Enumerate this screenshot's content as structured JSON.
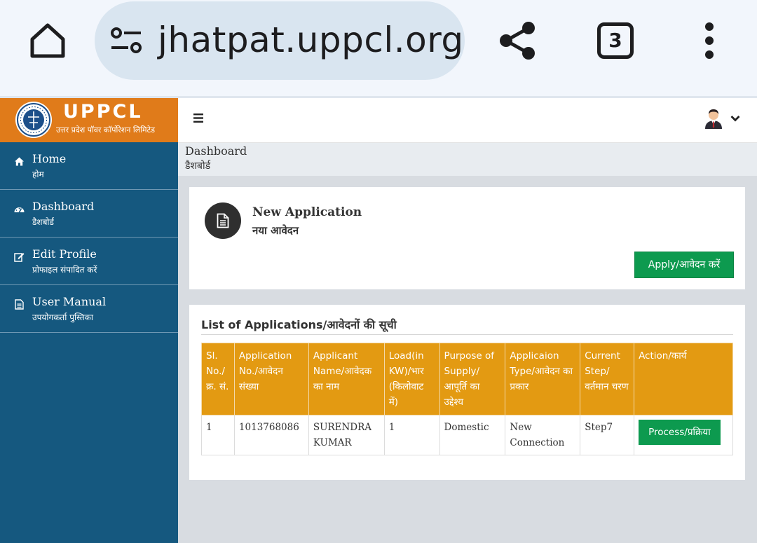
{
  "browser": {
    "url": "jhatpat.uppcl.org/c",
    "tab_count": "3",
    "icons": [
      "home-icon",
      "site-settings-icon",
      "share-icon",
      "tabs-icon",
      "overflow-menu-icon"
    ]
  },
  "brand": {
    "name": "UPPCL",
    "subtitle": "उत्तर प्रदेश पॉवर कॉर्पोरेशन लिमिटेड",
    "color": "#e07b1a"
  },
  "sidebar": {
    "color": "#15587f",
    "items": [
      {
        "label": "Home",
        "label_hi": "होम",
        "icon": "home-icon"
      },
      {
        "label": "Dashboard",
        "label_hi": "डैशबोर्ड",
        "icon": "dashboard-icon"
      },
      {
        "label": "Edit Profile",
        "label_hi": "प्रोफाइल संपादित करें",
        "icon": "edit-icon"
      },
      {
        "label": "User Manual",
        "label_hi": "उपयोगकर्ता पुस्तिका",
        "icon": "document-icon"
      }
    ]
  },
  "breadcrumb": {
    "title": "Dashboard",
    "title_hi": "डैशबोर्ड"
  },
  "new_application": {
    "title": "New Application",
    "title_hi": "नया आवेदन",
    "apply_label": "Apply/आवेदन करें"
  },
  "applications": {
    "title": "List of Applications/आवेदनों की सूची",
    "header_color": "#e39a12",
    "columns": [
      "Sl. No./ क्र. सं.",
      "Application No./आवेदन संख्या",
      "Applicant Name/आवेदक का नाम",
      "Load(in KW)/भार (किलोवाट में)",
      "Purpose of Supply/ आपूर्ति का उद्देश्य",
      "Applicaion Type/आवेदन का प्रकार",
      "Current Step/ वर्तमान चरण",
      "Action/कार्य"
    ],
    "rows": [
      {
        "sl": "1",
        "app_no": "1013768086",
        "name": "SURENDRA KUMAR",
        "load": "1",
        "purpose": "Domestic",
        "type": "New Connection",
        "step": "Step7",
        "action": "Process/प्रक्रिया"
      }
    ]
  },
  "accent_green": "#0d9a4f"
}
